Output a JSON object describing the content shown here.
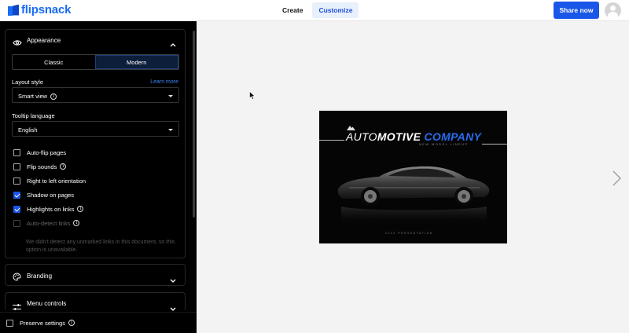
{
  "brand": {
    "name": "flipsnack"
  },
  "nav": {
    "tabs": [
      {
        "label": "Create"
      },
      {
        "label": "Customize"
      }
    ]
  },
  "header": {
    "share_label": "Share now"
  },
  "sidebar": {
    "appearance": {
      "title": "Appearance",
      "segment": {
        "options": [
          "Classic",
          "Modern"
        ],
        "selected": "Modern"
      },
      "layout_style": {
        "label": "Layout style",
        "learn_more": "Learn more",
        "value": "Smart view"
      },
      "tooltip_language": {
        "label": "Tooltip language",
        "value": "English"
      },
      "checkboxes": [
        {
          "label": "Auto-flip pages",
          "checked": false
        },
        {
          "label": "Flip sounds",
          "checked": false
        },
        {
          "label": "Right to left orientation",
          "checked": false
        },
        {
          "label": "Shadow on pages",
          "checked": true
        },
        {
          "label": "Highlights on links",
          "checked": true
        },
        {
          "label": "Auto-detect links",
          "checked": false,
          "disabled": true
        }
      ],
      "auto_detect_note": "We didn't detect any unmarked links in this document, so this option is unavailable."
    },
    "branding": {
      "title": "Branding"
    },
    "menu_controls": {
      "title": "Menu controls"
    },
    "footer": {
      "preserve_label": "Preserve settings"
    }
  },
  "flipbook": {
    "title_part1": "AUTO",
    "title_part2": "MOTIVE",
    "title_part3": " COMPANY",
    "subtitle": "NEW MODEL LINEUP",
    "footer": "2022 PRESENTATION",
    "accent": "#2a6cf0"
  },
  "colors": {
    "primary": "#1a56e8",
    "link": "#3b82f6",
    "sidebar_bg": "#000000",
    "preview_bg": "#f3f3f3"
  }
}
